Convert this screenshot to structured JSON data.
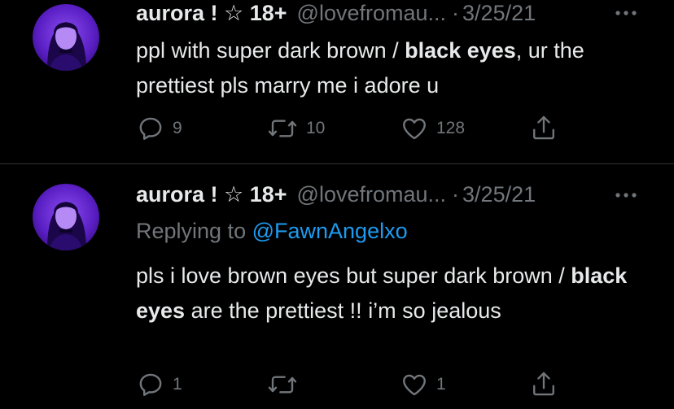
{
  "tweets": [
    {
      "name": "aurora ! ☆ 18+",
      "handle": "@lovefromau...",
      "date": "3/25/21",
      "text_plain_1": "ppl with super dark brown / ",
      "text_bold": "black eyes",
      "text_plain_2": ", ur the prettiest pls marry me i adore u",
      "replies": "9",
      "retweets": "10",
      "likes": "128"
    },
    {
      "name": "aurora ! ☆ 18+",
      "handle": "@lovefromau...",
      "date": "3/25/21",
      "replying_label": "Replying to ",
      "replying_to": "@FawnAngelxo",
      "text_plain_1": "pls i love brown eyes but super dark brown / ",
      "text_bold": "black eyes",
      "text_plain_2": " are the prettiest !! i’m so jealous",
      "replies": "1",
      "retweets": "",
      "likes": "1"
    }
  ],
  "separator": "·",
  "icons": {
    "reply": "reply-icon",
    "retweet": "retweet-icon",
    "like": "heart-icon",
    "share": "share-icon",
    "more": "more-icon"
  },
  "colors": {
    "background": "#000000",
    "text": "#e7e9ea",
    "muted": "#71767b",
    "link": "#1d9bf0",
    "divider": "#2f3336",
    "avatar_tint": "#6a2bd8"
  }
}
